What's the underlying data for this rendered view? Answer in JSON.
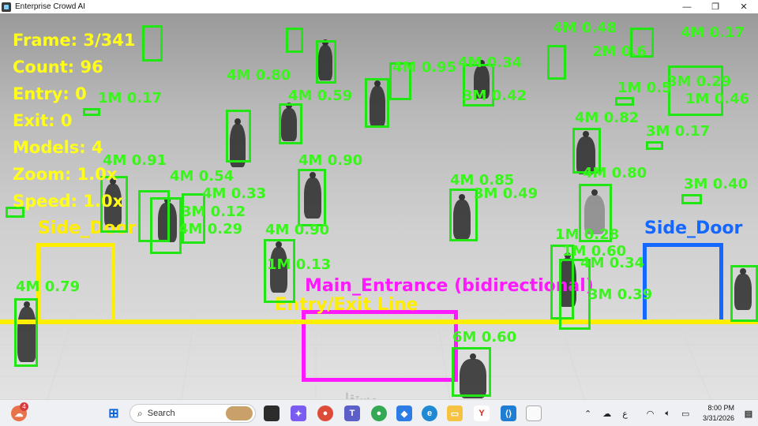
{
  "window": {
    "title": "Enterprise Crowd AI",
    "min": "—",
    "max": "❐",
    "close": "✕"
  },
  "hud": {
    "frame": "Frame: 3/341",
    "count": "Count: 96",
    "entry": "Entry: 0",
    "exit": "Exit: 0",
    "models": "Models: 4",
    "zoom": "Zoom: 1.0x",
    "speed": "Speed: 1.0x"
  },
  "zones": {
    "side_door_left": "Side_Door",
    "side_door_right": "Side_Door",
    "main_entrance": "Main_Entrance (bidirectional)",
    "entry_exit_line": "Entry/Exit Line"
  },
  "detections": [
    "4M 0.80",
    "4M 0.59",
    "4M 0.91",
    "4M 0.54",
    "4M 0.33",
    "3M 0.12",
    "4M 0.29",
    "4M 0.90",
    "1M 0.13",
    "4M 0.79",
    "4M 0.90",
    "4M 0.85",
    "3M 0.49",
    "4M 0.82",
    "3M 0.17",
    "4M 0.80",
    "3M 0.40",
    "1M 0.28",
    "3M 0.39",
    "4M 0.34",
    "1M 0.60",
    "6M 0.60",
    "3M 0.42",
    "1M 0.17",
    "4M 0.95",
    "4M 0.48",
    "2M 0.6",
    "4M 0.34",
    "1M 0.5",
    "3M 0.29",
    "1M 0.46",
    "4M 0.17"
  ],
  "watermark": "مستقل",
  "taskbar": {
    "notification_count": "4",
    "search_placeholder": "Search",
    "keyboard_lang": "ع",
    "time": "8:00 PM",
    "date": "3/31/2026"
  },
  "colors": {
    "detection": "#22e614",
    "hud": "#ffff1a",
    "zone_side_left": "#ffee00",
    "zone_side_right": "#1467ff",
    "zone_main": "#ff19ff"
  }
}
